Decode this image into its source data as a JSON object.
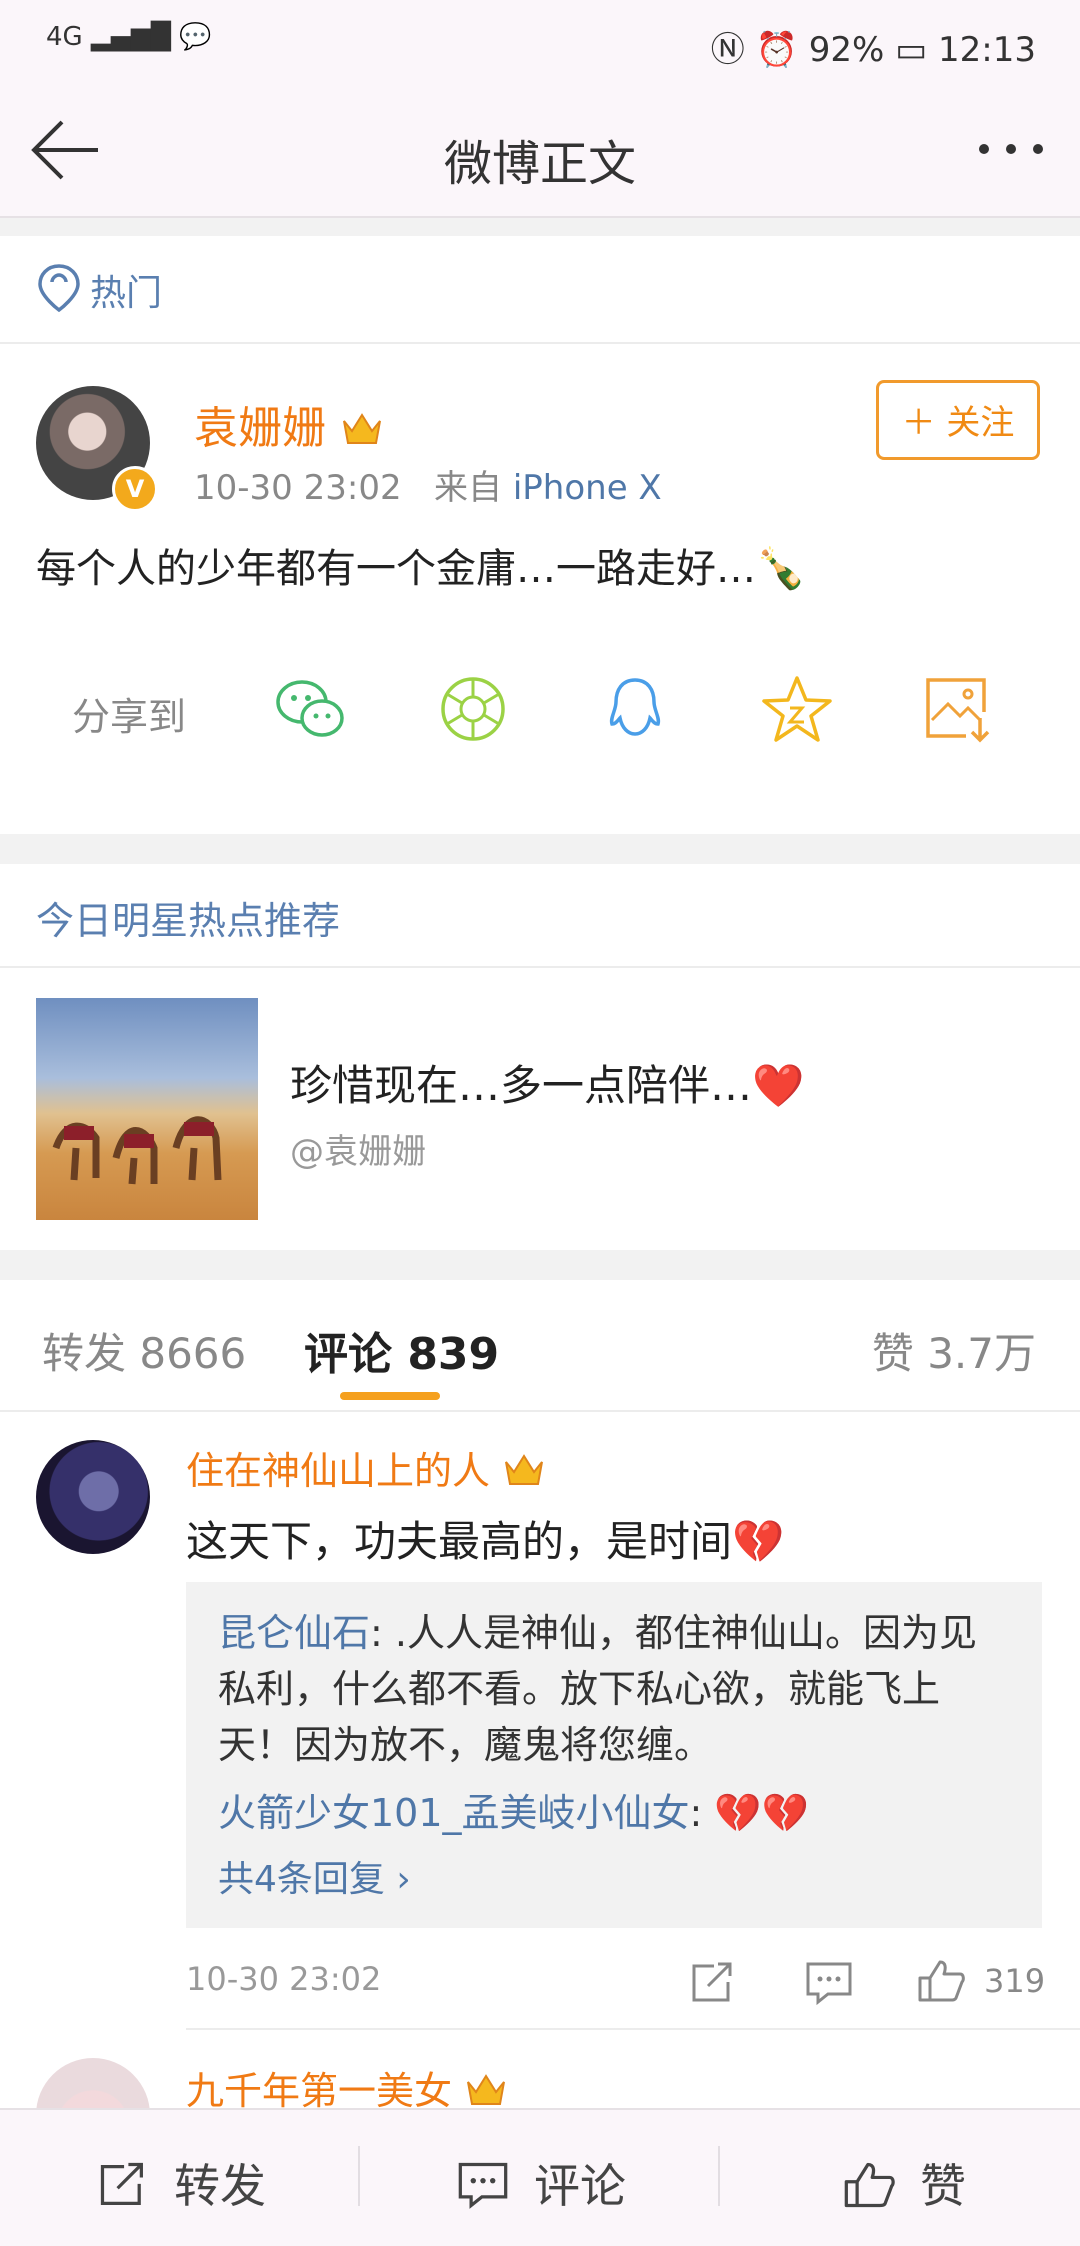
{
  "status_bar": {
    "signal": "4G",
    "battery": "92%",
    "time": "12:13"
  },
  "header": {
    "title": "微博正文"
  },
  "hot_tag": {
    "label": "热门"
  },
  "post": {
    "author": "袁姗姗",
    "time": "10-30 23:02",
    "source_prefix": "来自",
    "source": "iPhone X",
    "follow_label": "关注",
    "text": "每个人的少年都有一个金庸…一路走好…🍾",
    "share_label": "分享到"
  },
  "recommend": {
    "title": "今日明星热点推荐",
    "item_text": "珍惜现在…多一点陪伴…❤️",
    "item_author": "@袁姗姗"
  },
  "tabs": {
    "repost": "转发 8666",
    "comment": "评论 839",
    "like": "赞 3.7万"
  },
  "comments": [
    {
      "name": "住在神仙山上的人",
      "text": "这天下，功夫最高的，是时间💔",
      "replies": [
        {
          "user": "昆仑仙石",
          "line1": ": .人人是神仙，都住神仙山。因为见",
          "line2": "私利，什么都不看。放下私心欲，就能飞上",
          "line3": "天！因为放不，魔鬼将您缠。"
        },
        {
          "user": "火箭少女101_孟美岐小仙女",
          "text": ": 💔💔"
        }
      ],
      "more_replies": "共4条回复 ›",
      "time": "10-30 23:02",
      "likes": "319"
    },
    {
      "name": "九千年第一美女"
    }
  ],
  "bottom_bar": {
    "repost": "转发",
    "comment": "评论",
    "like": "赞"
  },
  "colors": {
    "accent_orange": "#f07a14",
    "link_blue": "#4f77a8",
    "tab_underline": "#f5a01e"
  }
}
